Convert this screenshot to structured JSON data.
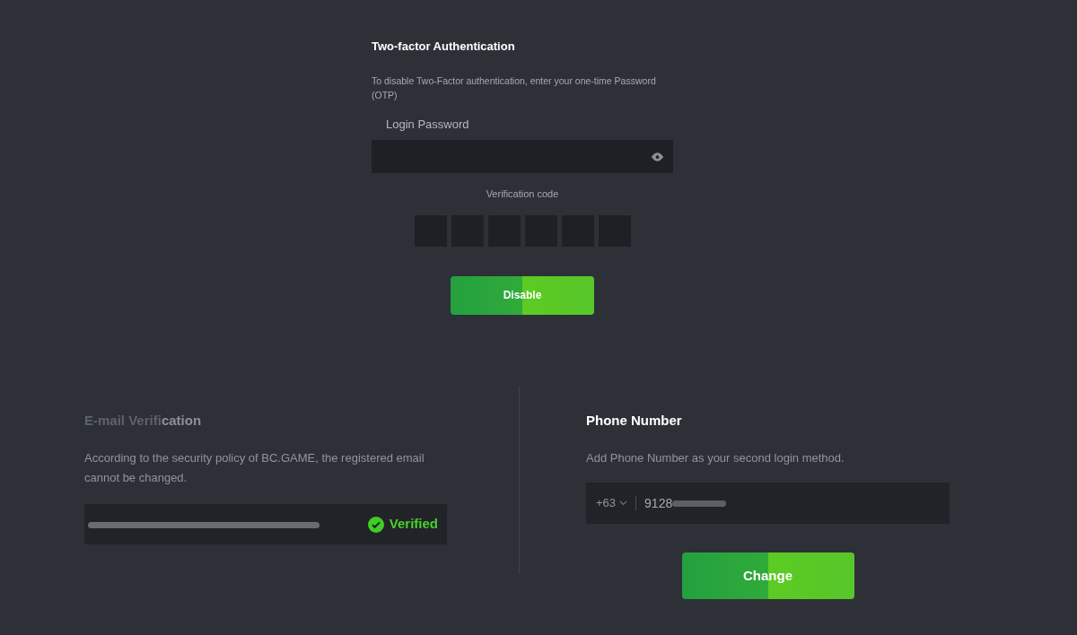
{
  "two_factor": {
    "title": "Two-factor Authentication",
    "description": "To disable Two-Factor authentication, enter your one-time Password (OTP)",
    "password_label": "Login Password",
    "code_label": "Verification code",
    "code_digits": [
      {
        "filled": false
      },
      {
        "filled": false
      },
      {
        "filled": false
      },
      {
        "filled": false
      },
      {
        "filled": false
      },
      {
        "filled": false
      }
    ],
    "button": "Disable"
  },
  "email": {
    "title_faded": "E-mail Verifi",
    "title_rest": "cation",
    "description": "According to the security policy of BC.GAME, the registered email cannot be changed.",
    "verified": true,
    "status": "Verified"
  },
  "phone": {
    "title": "Phone Number",
    "description": "Add Phone Number as your second login method.",
    "country_code": "+63",
    "number": "9128",
    "button": "Change"
  }
}
